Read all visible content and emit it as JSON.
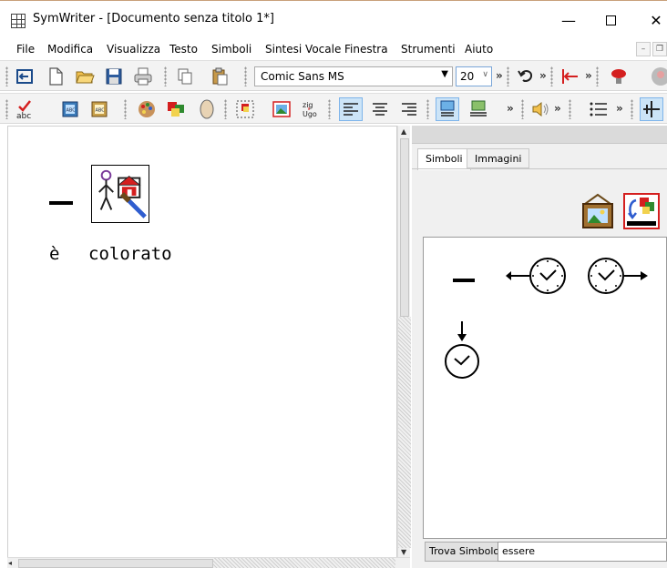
{
  "window": {
    "title": "SymWriter - [Documento senza titolo 1*]",
    "minimize_glyph": "—",
    "close_glyph": "✕"
  },
  "menu": [
    {
      "label": "File"
    },
    {
      "label": "Modifica"
    },
    {
      "label": "Visualizza"
    },
    {
      "label": "Testo"
    },
    {
      "label": "Simboli"
    },
    {
      "label": "Sintesi Vocale"
    },
    {
      "label": "Finestra"
    },
    {
      "label": "Strumenti"
    },
    {
      "label": "Aiuto"
    }
  ],
  "toolbar": {
    "font_name": "Comic Sans MS",
    "font_size": "20",
    "more_glyph": "»"
  },
  "document": {
    "words": [
      {
        "text": "è"
      },
      {
        "text": "colorato"
      }
    ],
    "symbols": [
      "dash-symbol",
      "painting-symbol"
    ]
  },
  "symbol_panel": {
    "tabs": [
      {
        "label": "Simboli",
        "active": true
      },
      {
        "label": "Immagini",
        "active": false
      }
    ],
    "results": [
      "dash-symbol",
      "clock-arrow-left-symbol",
      "clock-arrow-right-symbol",
      "clock-arrow-down-symbol"
    ],
    "find_button_label": "Trova Simbolo",
    "search_value": "essere"
  },
  "colors": {
    "accent_selection": "#cce4f7",
    "red_frame": "#d41f1f"
  },
  "icons": [
    "grid-app-icon",
    "exit-icon",
    "new-document-icon",
    "open-folder-icon",
    "save-icon",
    "print-icon",
    "copy-icon",
    "paste-icon",
    "undo-icon",
    "insert-break-icon",
    "speech-bubble-icon",
    "spellcheck-icon",
    "symbol-book-icon",
    "palette-icon",
    "colored-squares-icon",
    "oval-icon",
    "frame-select-icon",
    "picture-icon",
    "zig-ugo-icon",
    "align-left-icon",
    "align-center-icon",
    "align-right-icon",
    "layout-icon",
    "speaker-icon",
    "list-icon",
    "grid-plus-icon"
  ]
}
